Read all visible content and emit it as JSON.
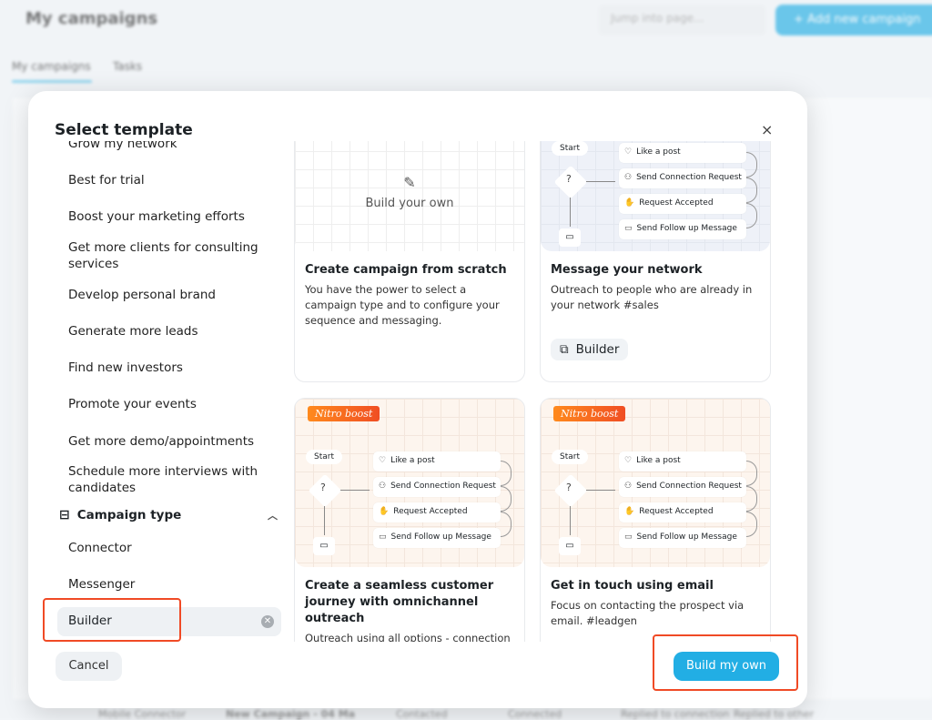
{
  "background": {
    "title": "My campaigns",
    "jump_placeholder": "Jump into page...",
    "add_button": "+ Add new campaign",
    "tabs": [
      "My campaigns",
      "Tasks"
    ],
    "row": [
      "Mobile Connector",
      "New Campaign - 04 Ma",
      "Contacted",
      "Connected",
      "Replied to connection",
      "Replied to other"
    ]
  },
  "modal": {
    "title": "Select template",
    "close": "×",
    "goals": [
      "Grow my network",
      "Best for trial",
      "Boost your marketing efforts",
      "Get more clients for consulting services",
      "Develop personal brand",
      "Generate more leads",
      "Find new investors",
      "Promote your events",
      "Get more demo/appointments",
      "Schedule more interviews with candidates"
    ],
    "campaign_type": {
      "label": "Campaign type",
      "options": [
        "Connector",
        "Messenger"
      ],
      "selected": "Builder"
    },
    "cancel": "Cancel",
    "build_my_own": "Build my own"
  },
  "diagram": {
    "start": "Start",
    "question": "?",
    "steps": [
      "Like a post",
      "Send Connection Request",
      "Request Accepted",
      "Send Follow up Message"
    ]
  },
  "cards": [
    {
      "title": "Create campaign from scratch",
      "desc": "You have the power to select a campaign type and to configure your sequence and messaging.",
      "image_label": "Build your own"
    },
    {
      "title": "Message your network",
      "desc": "Outreach to people who are already in your network #sales",
      "chip": "Builder"
    },
    {
      "title": "Create a seamless customer journey with omnichannel outreach",
      "desc": "Outreach using all options - connection request, InMail & emails. #leadgen",
      "badge": "Nitro boost"
    },
    {
      "title": "Get in touch using email",
      "desc": "Focus on contacting the prospect via email. #leadgen",
      "badge": "Nitro boost"
    }
  ],
  "colors": {
    "accent": "#22aee4",
    "highlight": "#f04a25",
    "nitro": "#f04e23"
  }
}
